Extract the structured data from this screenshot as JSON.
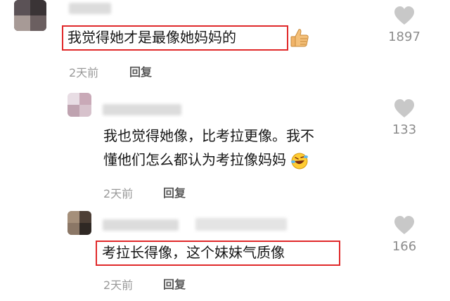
{
  "comments": [
    {
      "text": "我觉得她才是最像她妈妈的",
      "time": "2天前",
      "reply_label": "回复",
      "likes": "1897",
      "emoji": "thumbs-up-emoji",
      "highlighted": true
    },
    {
      "text_line1": "我也觉得她像，比考拉更像。我不",
      "text_line2": "懂他们怎么都认为考拉像妈妈",
      "time": "2天前",
      "reply_label": "回复",
      "likes": "133",
      "emoji": "rolling-laughing-emoji",
      "highlighted": false
    },
    {
      "text": "考拉长得像，这个妹妹气质像",
      "time": "2天前",
      "reply_label": "回复",
      "likes": "166",
      "highlighted": true
    }
  ],
  "colors": {
    "highlight_border": "#e0292a",
    "heart_icon": "#c8c8c8",
    "meta_text": "#9a9a9a",
    "reply_text": "#5a5a5a"
  }
}
